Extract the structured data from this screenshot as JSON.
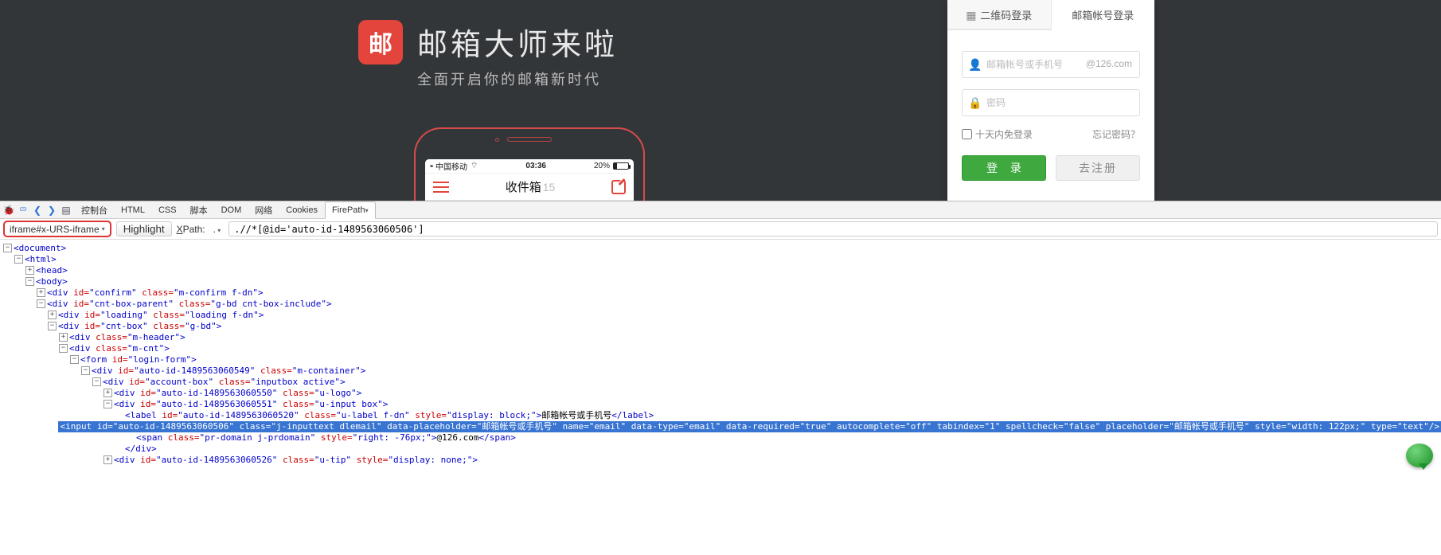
{
  "promo": {
    "logo_letter": "邮",
    "title": "邮箱大师来啦",
    "subtitle": "全面开启你的邮箱新时代"
  },
  "phone": {
    "carrier": "中国移动",
    "time": "03:36",
    "battery_pct": "20%",
    "inbox_title": "收件箱",
    "inbox_count": "15"
  },
  "login": {
    "tab_qr": "二维码登录",
    "tab_account": "邮箱帐号登录",
    "email_placeholder": "邮箱帐号或手机号",
    "domain_suffix": "@126.com",
    "password_placeholder": "密码",
    "remember": "十天内免登录",
    "forgot": "忘记密码？",
    "btn_login": "登 录",
    "btn_register": "去注册"
  },
  "devtools": {
    "tabs": [
      "控制台",
      "HTML",
      "CSS",
      "脚本",
      "DOM",
      "网络",
      "Cookies",
      "FirePath"
    ],
    "iframe_selector": "iframe#x-URS-iframe",
    "highlight": "Highlight",
    "xpath_label": "XPath:",
    "xpath_dot": ".",
    "xpath_value": ".//*[@id='auto-id-1489563060506']",
    "tree": {
      "l1": "<document>",
      "l2": "<html>",
      "l3": "<head>",
      "l4": "<body>",
      "l5": {
        "open": "<div",
        "close": ">",
        "attrs": [
          [
            "id",
            "confirm"
          ],
          [
            "class",
            "m-confirm f-dn"
          ]
        ]
      },
      "l6": {
        "open": "<div",
        "close": ">",
        "attrs": [
          [
            "id",
            "cnt-box-parent"
          ],
          [
            "class",
            "g-bd cnt-box-include"
          ]
        ]
      },
      "l7": {
        "open": "<div",
        "close": ">",
        "attrs": [
          [
            "id",
            "loading"
          ],
          [
            "class",
            "loading f-dn"
          ]
        ]
      },
      "l8": {
        "open": "<div",
        "close": ">",
        "attrs": [
          [
            "id",
            "cnt-box"
          ],
          [
            "class",
            "g-bd"
          ]
        ]
      },
      "l9": {
        "open": "<div",
        "close": ">",
        "attrs": [
          [
            "class",
            "m-header"
          ]
        ]
      },
      "l10": {
        "open": "<div",
        "close": ">",
        "attrs": [
          [
            "class",
            "m-cnt"
          ]
        ]
      },
      "l11": {
        "open": "<form",
        "close": ">",
        "attrs": [
          [
            "id",
            "login-form"
          ]
        ]
      },
      "l12": {
        "open": "<div",
        "close": ">",
        "attrs": [
          [
            "id",
            "auto-id-1489563060549"
          ],
          [
            "class",
            "m-container"
          ]
        ]
      },
      "l13": {
        "open": "<div",
        "close": ">",
        "attrs": [
          [
            "id",
            "account-box"
          ],
          [
            "class",
            "inputbox active"
          ]
        ]
      },
      "l14": {
        "open": "<div",
        "close": ">",
        "attrs": [
          [
            "id",
            "auto-id-1489563060550"
          ],
          [
            "class",
            "u-logo"
          ]
        ]
      },
      "l15": {
        "open": "<div",
        "close": ">",
        "attrs": [
          [
            "id",
            "auto-id-1489563060551"
          ],
          [
            "class",
            "u-input box"
          ]
        ]
      },
      "l16_pre": {
        "open": "<label",
        "close": ">",
        "attrs": [
          [
            "id",
            "auto-id-1489563060520"
          ],
          [
            "class",
            "u-label f-dn"
          ],
          [
            "style",
            "display: block;"
          ]
        ]
      },
      "l16_text": "邮箱帐号或手机号",
      "l16_close": "</label>",
      "l17": {
        "open": "<input",
        "close": "/>",
        "attrs": [
          [
            "id",
            "auto-id-1489563060506"
          ],
          [
            "class",
            "j-inputtext dlemail"
          ],
          [
            "data-placeholder",
            "邮箱帐号或手机号"
          ],
          [
            "name",
            "email"
          ],
          [
            "data-type",
            "email"
          ],
          [
            "data-required",
            "true"
          ],
          [
            "autocomplete",
            "off"
          ],
          [
            "tabindex",
            "1"
          ],
          [
            "spellcheck",
            "false"
          ],
          [
            "placeholder",
            "邮箱帐号或手机号"
          ],
          [
            "style",
            "width: 122px;"
          ],
          [
            "type",
            "text"
          ]
        ]
      },
      "l18_pre": {
        "open": "<span",
        "close": ">",
        "attrs": [
          [
            "class",
            "pr-domain j-prdomain"
          ],
          [
            "style",
            "right: -76px;"
          ]
        ]
      },
      "l18_text": "@126.com",
      "l18_close": "</span>",
      "l19": "</div>",
      "l20": {
        "open": "<div",
        "close": ">",
        "attrs": [
          [
            "id",
            "auto-id-1489563060526"
          ],
          [
            "class",
            "u-tip"
          ],
          [
            "style",
            "display: none;"
          ]
        ]
      }
    }
  }
}
